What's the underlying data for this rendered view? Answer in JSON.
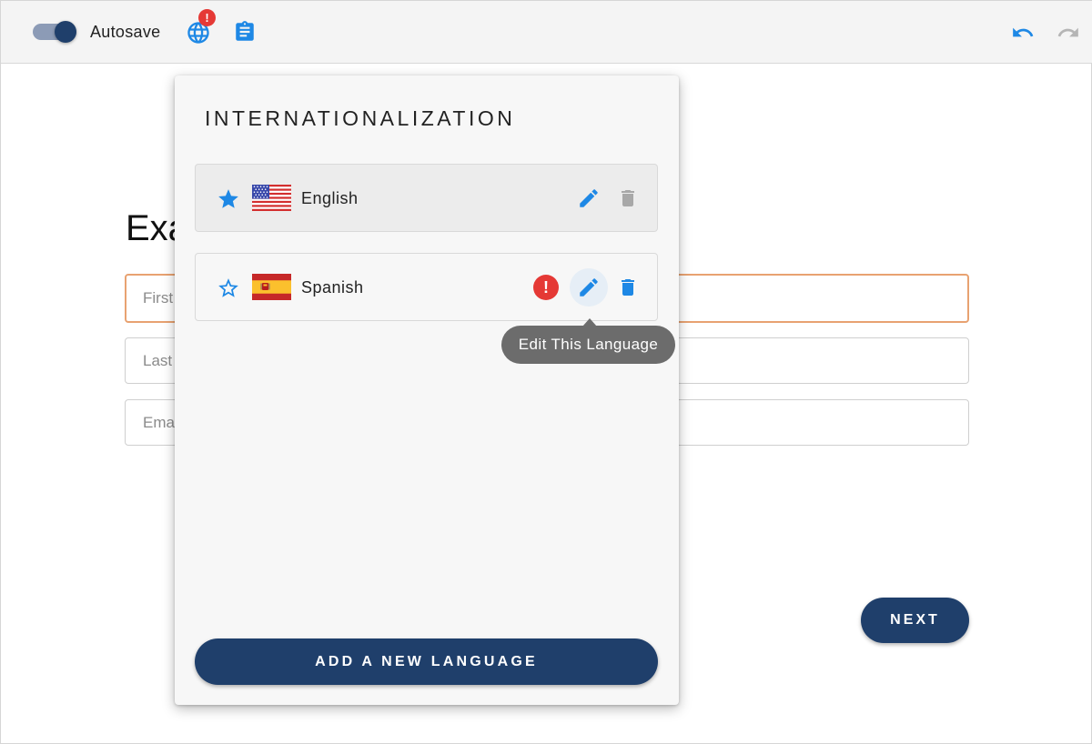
{
  "toolbar": {
    "autosave_label": "Autosave",
    "autosave_on": true,
    "globe_badge": "!",
    "icons": [
      "toggle",
      "globe-icon",
      "clipboard-icon",
      "undo-icon",
      "redo-icon"
    ]
  },
  "form": {
    "heading": "Exa",
    "fields": [
      {
        "placeholder": "First"
      },
      {
        "placeholder": "Last"
      },
      {
        "placeholder": "Ema"
      }
    ],
    "next_label": "NEXT"
  },
  "panel": {
    "title": "INTERNATIONALIZATION",
    "languages": [
      {
        "name": "English",
        "default": true,
        "flag": "us-flag-icon",
        "has_error": false
      },
      {
        "name": "Spanish",
        "default": false,
        "flag": "spain-flag-icon",
        "has_error": true,
        "error_symbol": "!"
      }
    ],
    "tooltip": "Edit This Language",
    "add_label": "ADD A NEW LANGUAGE"
  },
  "colors": {
    "primary": "#1f3f6b",
    "accent_blue": "#1e88e5",
    "error": "#e53935",
    "focus_border": "#e8a271",
    "disabled_icon": "#a8a8a8"
  }
}
